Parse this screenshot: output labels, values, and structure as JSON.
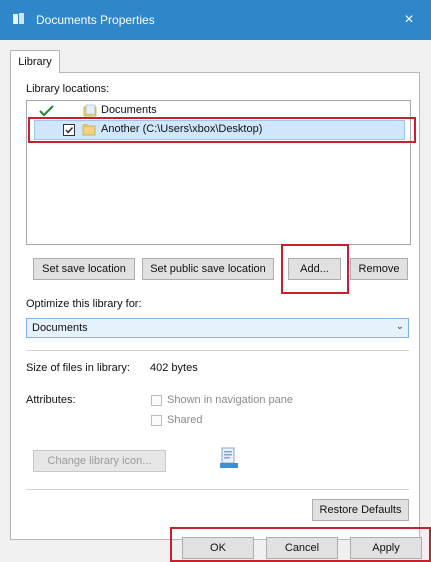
{
  "window": {
    "title": "Documents Properties",
    "close_glyph": "×"
  },
  "tabs": [
    {
      "label": "Library"
    }
  ],
  "library_locations": {
    "label": "Library locations:",
    "items": [
      {
        "text": "Documents",
        "icon": "folder-icon",
        "checked": false
      },
      {
        "text": "Another (C:\\Users\\xbox\\Desktop)",
        "icon": "folder-icon",
        "checked": true
      }
    ]
  },
  "location_buttons": {
    "set_save": "Set save location",
    "set_public_save": "Set public save location",
    "add": "Add...",
    "remove": "Remove"
  },
  "optimize": {
    "label": "Optimize this library for:",
    "value": "Documents"
  },
  "size": {
    "label": "Size of files in library:",
    "value": "402 bytes"
  },
  "attributes": {
    "label": "Attributes:",
    "shown_in_nav": "Shown in navigation pane",
    "shared": "Shared"
  },
  "icon_section": {
    "change_button": "Change library icon..."
  },
  "restore_defaults": "Restore Defaults",
  "footer": {
    "ok": "OK",
    "cancel": "Cancel",
    "apply": "Apply"
  },
  "colors": {
    "titlebar": "#2f86c8",
    "highlight": "#c8202c",
    "selection": "#cfe6fb"
  }
}
